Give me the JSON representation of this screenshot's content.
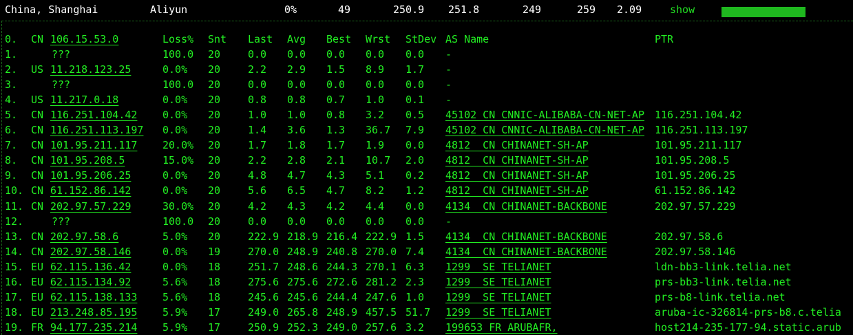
{
  "topbar": {
    "location": "China, Shanghai",
    "provider": "Aliyun",
    "loss": "0%",
    "snt": "49",
    "last": "250.9",
    "avg": "251.8",
    "best": "249",
    "wrst": "259",
    "stdev": "2.09",
    "show_label": "show"
  },
  "header": {
    "idx": "0.",
    "cc": "CN",
    "host": "106.15.53.0",
    "loss": "Loss%",
    "snt": "Snt",
    "last": "Last",
    "avg": "Avg",
    "best": "Best",
    "wrst": "Wrst",
    "stdev": "StDev",
    "as": "AS Name",
    "ptr": "PTR"
  },
  "rows": [
    {
      "idx": "1.",
      "cc": "",
      "host": "???",
      "loss": "100.0",
      "snt": "20",
      "last": "0.0",
      "avg": "0.0",
      "best": "0.0",
      "wrst": "0.0",
      "stdev": "0.0",
      "as": "-",
      "ptr": ""
    },
    {
      "idx": "2.",
      "cc": "US",
      "host": "11.218.123.25",
      "loss": "0.0%",
      "snt": "20",
      "last": "2.2",
      "avg": "2.9",
      "best": "1.5",
      "wrst": "8.9",
      "stdev": "1.7",
      "as": "-",
      "ptr": ""
    },
    {
      "idx": "3.",
      "cc": "",
      "host": "???",
      "loss": "100.0",
      "snt": "20",
      "last": "0.0",
      "avg": "0.0",
      "best": "0.0",
      "wrst": "0.0",
      "stdev": "0.0",
      "as": "-",
      "ptr": ""
    },
    {
      "idx": "4.",
      "cc": "US",
      "host": "11.217.0.18",
      "loss": "0.0%",
      "snt": "20",
      "last": "0.8",
      "avg": "0.8",
      "best": "0.7",
      "wrst": "1.0",
      "stdev": "0.1",
      "as": "-",
      "ptr": ""
    },
    {
      "idx": "5.",
      "cc": "CN",
      "host": "116.251.104.42",
      "loss": "0.0%",
      "snt": "20",
      "last": "1.0",
      "avg": "1.0",
      "best": "0.8",
      "wrst": "3.2",
      "stdev": "0.5",
      "as": "45102 CN CNNIC-ALIBABA-CN-NET-AP",
      "ptr": "116.251.104.42"
    },
    {
      "idx": "6.",
      "cc": "CN",
      "host": "116.251.113.197",
      "loss": "0.0%",
      "snt": "20",
      "last": "1.4",
      "avg": "3.6",
      "best": "1.3",
      "wrst": "36.7",
      "stdev": "7.9",
      "as": "45102 CN CNNIC-ALIBABA-CN-NET-AP",
      "ptr": "116.251.113.197"
    },
    {
      "idx": "7.",
      "cc": "CN",
      "host": "101.95.211.117",
      "loss": "20.0%",
      "snt": "20",
      "last": "1.7",
      "avg": "1.8",
      "best": "1.7",
      "wrst": "1.9",
      "stdev": "0.0",
      "as": "4812  CN CHINANET-SH-AP",
      "ptr": "101.95.211.117"
    },
    {
      "idx": "8.",
      "cc": "CN",
      "host": "101.95.208.5",
      "loss": "15.0%",
      "snt": "20",
      "last": "2.2",
      "avg": "2.8",
      "best": "2.1",
      "wrst": "10.7",
      "stdev": "2.0",
      "as": "4812  CN CHINANET-SH-AP",
      "ptr": "101.95.208.5"
    },
    {
      "idx": "9.",
      "cc": "CN",
      "host": "101.95.206.25",
      "loss": "0.0%",
      "snt": "20",
      "last": "4.8",
      "avg": "4.7",
      "best": "4.3",
      "wrst": "5.1",
      "stdev": "0.2",
      "as": "4812  CN CHINANET-SH-AP",
      "ptr": "101.95.206.25"
    },
    {
      "idx": "10.",
      "cc": "CN",
      "host": "61.152.86.142",
      "loss": "0.0%",
      "snt": "20",
      "last": "5.6",
      "avg": "6.5",
      "best": "4.7",
      "wrst": "8.2",
      "stdev": "1.2",
      "as": "4812  CN CHINANET-SH-AP",
      "ptr": "61.152.86.142"
    },
    {
      "idx": "11.",
      "cc": "CN",
      "host": "202.97.57.229",
      "loss": "30.0%",
      "snt": "20",
      "last": "4.2",
      "avg": "4.3",
      "best": "4.2",
      "wrst": "4.4",
      "stdev": "0.0",
      "as": "4134  CN CHINANET-BACKBONE",
      "ptr": "202.97.57.229"
    },
    {
      "idx": "12.",
      "cc": "",
      "host": "???",
      "loss": "100.0",
      "snt": "20",
      "last": "0.0",
      "avg": "0.0",
      "best": "0.0",
      "wrst": "0.0",
      "stdev": "0.0",
      "as": "-",
      "ptr": ""
    },
    {
      "idx": "13.",
      "cc": "CN",
      "host": "202.97.58.6",
      "loss": "5.0%",
      "snt": "20",
      "last": "222.9",
      "avg": "218.9",
      "best": "216.4",
      "wrst": "222.9",
      "stdev": "1.5",
      "as": "4134  CN CHINANET-BACKBONE",
      "ptr": "202.97.58.6"
    },
    {
      "idx": "14.",
      "cc": "CN",
      "host": "202.97.58.146",
      "loss": "0.0%",
      "snt": "19",
      "last": "270.0",
      "avg": "248.9",
      "best": "240.8",
      "wrst": "270.0",
      "stdev": "7.4",
      "as": "4134  CN CHINANET-BACKBONE",
      "ptr": "202.97.58.146"
    },
    {
      "idx": "15.",
      "cc": "EU",
      "host": "62.115.136.42",
      "loss": "0.0%",
      "snt": "18",
      "last": "251.7",
      "avg": "248.6",
      "best": "244.3",
      "wrst": "270.1",
      "stdev": "6.3",
      "as": "1299  SE TELIANET",
      "ptr": "ldn-bb3-link.telia.net"
    },
    {
      "idx": "16.",
      "cc": "EU",
      "host": "62.115.134.92",
      "loss": "5.6%",
      "snt": "18",
      "last": "275.6",
      "avg": "275.6",
      "best": "272.6",
      "wrst": "281.2",
      "stdev": "2.3",
      "as": "1299  SE TELIANET",
      "ptr": "prs-bb3-link.telia.net"
    },
    {
      "idx": "17.",
      "cc": "EU",
      "host": "62.115.138.133",
      "loss": "5.6%",
      "snt": "18",
      "last": "245.6",
      "avg": "245.6",
      "best": "244.4",
      "wrst": "247.6",
      "stdev": "1.0",
      "as": "1299  SE TELIANET",
      "ptr": "prs-b8-link.telia.net"
    },
    {
      "idx": "18.",
      "cc": "EU",
      "host": "213.248.85.195",
      "loss": "5.9%",
      "snt": "17",
      "last": "249.0",
      "avg": "265.8",
      "best": "248.9",
      "wrst": "457.5",
      "stdev": "51.7",
      "as": "1299  SE TELIANET",
      "ptr": "aruba-ic-326814-prs-b8.c.telia"
    },
    {
      "idx": "19.",
      "cc": "FR",
      "host": "94.177.235.214",
      "loss": "5.9%",
      "snt": "17",
      "last": "250.9",
      "avg": "252.3",
      "best": "249.0",
      "wrst": "257.6",
      "stdev": "3.2",
      "as": "199653 FR ARUBAFR,",
      "ptr": "host214-235-177-94.static.arub"
    }
  ]
}
